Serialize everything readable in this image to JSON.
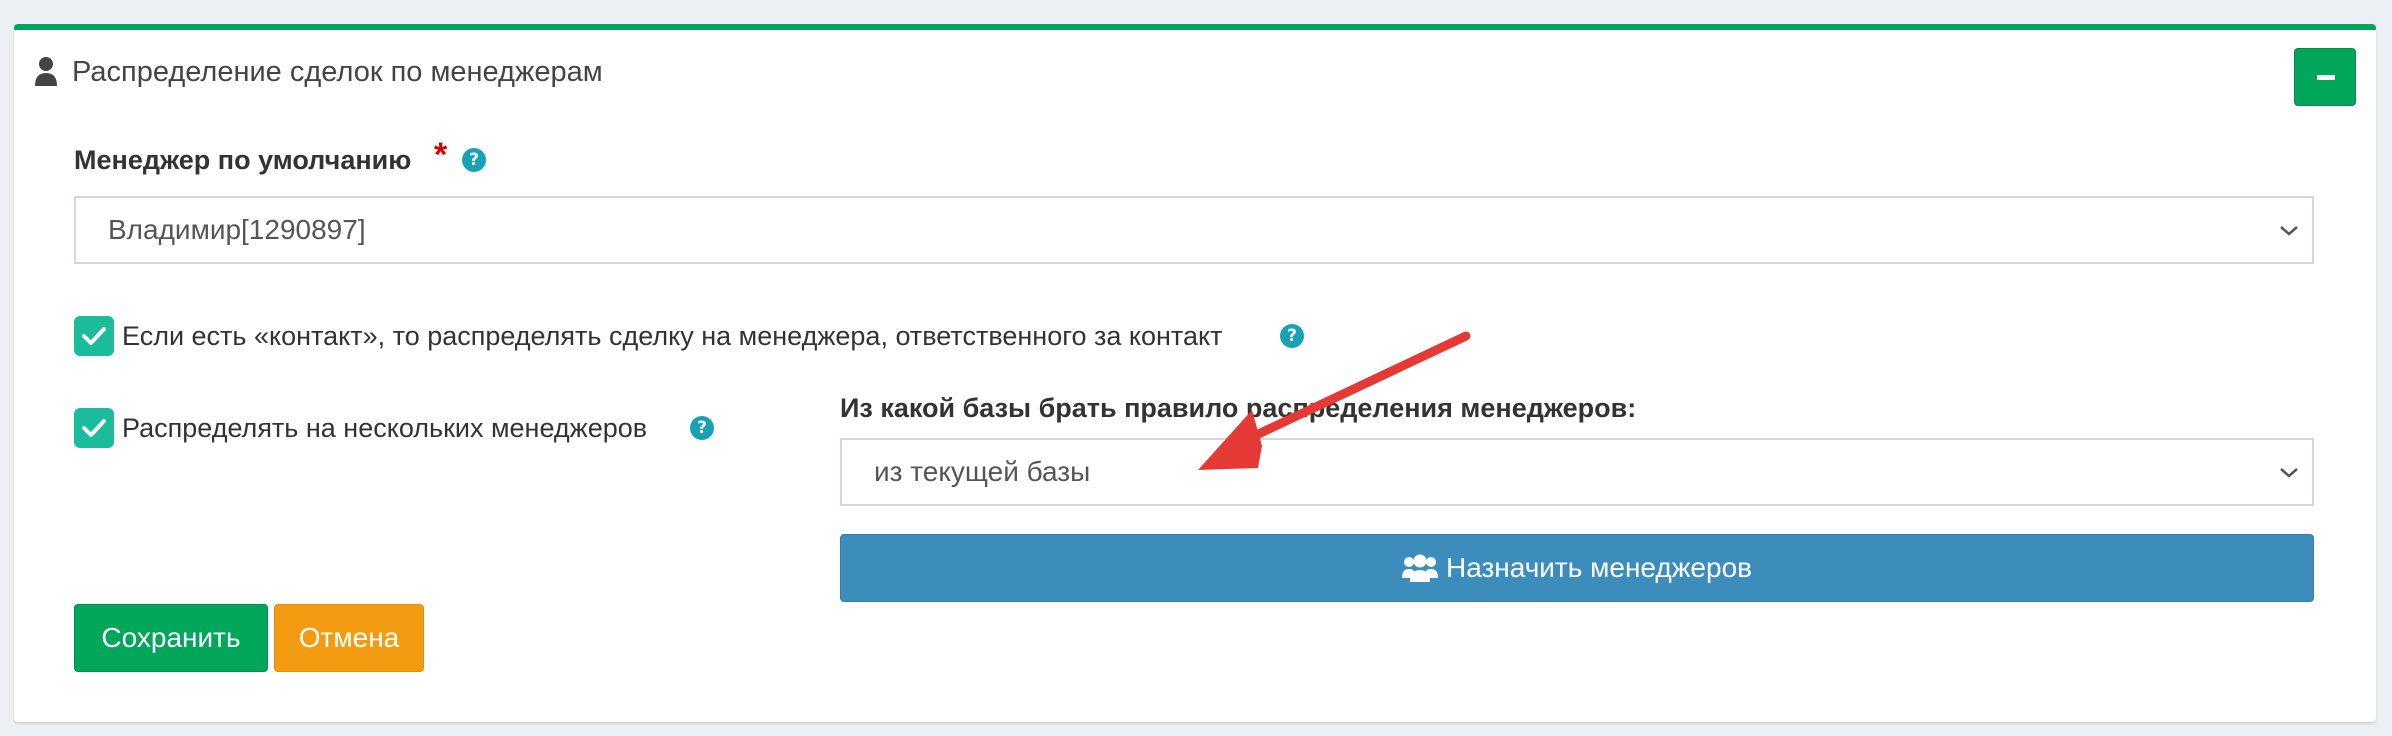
{
  "panel": {
    "title": "Распределение сделок по менеджерам",
    "accent_color": "#00a65a",
    "title_icon": "user-icon",
    "collapse_icon": "minus-icon"
  },
  "default_manager": {
    "label": "Менеджер по умолчанию",
    "required_mark": "*",
    "help": "?",
    "selected": "Владимир[1290897]"
  },
  "contact_rule": {
    "checked": true,
    "label": "Если есть «контакт», то распределять сделку на менеджера, ответственного за контакт",
    "help": "?"
  },
  "multi_managers": {
    "checked": true,
    "label": "Распределять на нескольких менеджеров",
    "help": "?"
  },
  "base_rule": {
    "label": "Из какой базы брать правило распределения менеджеров:",
    "selected": "из текущей базы"
  },
  "buttons": {
    "assign_label": "Назначить менеджеров",
    "assign_icon": "users-icon",
    "save_label": "Сохранить",
    "cancel_label": "Отмена"
  },
  "annotation": {
    "arrow_color": "#e53935"
  }
}
